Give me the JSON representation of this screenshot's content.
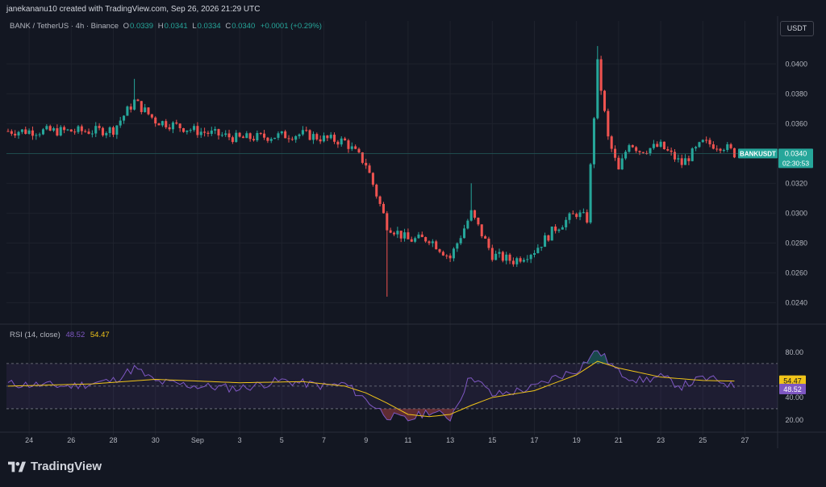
{
  "header": {
    "attribution": "janekananu10 created with TradingView.com, Sep 26, 2026 21:29 UTC"
  },
  "legend": {
    "symbol": "BANK / TetherUS · 4h · Binance",
    "o_label": "O",
    "o_value": "0.0339",
    "h_label": "H",
    "h_value": "0.0341",
    "l_label": "L",
    "l_value": "0.0334",
    "c_label": "C",
    "c_value": "0.0340",
    "change": "+0.0001 (+0.29%)"
  },
  "currency_button": "USDT",
  "price_label": {
    "symbol": "BANKUSDT",
    "price": "0.0340",
    "countdown": "02:30:53"
  },
  "rsi_legend": {
    "title": "RSI (14, close)",
    "rsi_value": "48.52",
    "ma_value": "54.47"
  },
  "rsi_labels": {
    "ma": "54.47",
    "rsi": "48.52"
  },
  "brand": {
    "name": "TradingView"
  },
  "colors": {
    "up": "#26a69a",
    "down": "#ef5350",
    "rsi": "#7e57c2",
    "rsi_ma": "#f0c419",
    "background": "#131722"
  },
  "chart_data": [
    {
      "type": "candlestick",
      "title": "BANK / TetherUS · 4h · Binance",
      "yticks": [
        "0.0400",
        "0.0380",
        "0.0360",
        "0.0340",
        "0.0320",
        "0.0300",
        "0.0280",
        "0.0260",
        "0.0240"
      ],
      "xticks": [
        "24",
        "26",
        "28",
        "30",
        "Sep",
        "3",
        "5",
        "7",
        "9",
        "11",
        "13",
        "15",
        "17",
        "19",
        "21",
        "23",
        "25",
        "27"
      ],
      "ylim": [
        0.0231,
        0.0418
      ],
      "last_price": 0.034,
      "grid": true,
      "trend_keyframes": [
        {
          "x": "Aug 23",
          "close": 0.0355
        },
        {
          "x": "Aug 27",
          "close": 0.0355
        },
        {
          "x": "Aug 28",
          "close": 0.0356
        },
        {
          "x": "Aug 29",
          "close": 0.0375
        },
        {
          "x": "Aug 30",
          "close": 0.0362
        },
        {
          "x": "Sep 1",
          "close": 0.0355
        },
        {
          "x": "Sep 3",
          "close": 0.035
        },
        {
          "x": "Sep 5",
          "close": 0.0352
        },
        {
          "x": "Sep 6",
          "close": 0.0353
        },
        {
          "x": "Sep 7",
          "close": 0.035
        },
        {
          "x": "Sep 8",
          "close": 0.0348
        },
        {
          "x": "Sep 9",
          "close": 0.0333
        },
        {
          "x": "Sep 10",
          "close": 0.0292
        },
        {
          "x": "Sep 11",
          "close": 0.0282
        },
        {
          "x": "Sep 12",
          "close": 0.0283
        },
        {
          "x": "Sep 13",
          "close": 0.027
        },
        {
          "x": "Sep 14",
          "close": 0.03
        },
        {
          "x": "Sep 15",
          "close": 0.0272
        },
        {
          "x": "Sep 16",
          "close": 0.0268
        },
        {
          "x": "Sep 17",
          "close": 0.0275
        },
        {
          "x": "Sep 18",
          "close": 0.029
        },
        {
          "x": "Sep 19",
          "close": 0.03
        },
        {
          "x": "Sep 19 12:00",
          "close": 0.0296
        },
        {
          "x": "Sep 20",
          "close": 0.04
        },
        {
          "x": "Sep 20 12:00",
          "close": 0.035
        },
        {
          "x": "Sep 21",
          "close": 0.0328
        },
        {
          "x": "Sep 21 12:00",
          "close": 0.0348
        },
        {
          "x": "Sep 22",
          "close": 0.0342
        },
        {
          "x": "Sep 23",
          "close": 0.0345
        },
        {
          "x": "Sep 24",
          "close": 0.0333
        },
        {
          "x": "Sep 25",
          "close": 0.0347
        },
        {
          "x": "Sep 26",
          "close": 0.0345
        },
        {
          "x": "Sep 26 12:00",
          "close": 0.034
        }
      ],
      "spikes": [
        {
          "x": "Aug 29",
          "high": 0.039
        },
        {
          "x": "Sep 10",
          "low": 0.0244
        },
        {
          "x": "Sep 14",
          "high": 0.032
        },
        {
          "x": "Sep 20",
          "high": 0.0412
        }
      ]
    },
    {
      "type": "line",
      "title": "RSI (14, close)",
      "yticks": [
        "80.00",
        "40.00",
        "20.00"
      ],
      "ylim": [
        10,
        92
      ],
      "band": [
        30,
        70
      ],
      "series": [
        {
          "name": "RSI",
          "keyframes": [
            {
              "x": "Aug 23",
              "y": 52
            },
            {
              "x": "Aug 26",
              "y": 50
            },
            {
              "x": "Aug 28",
              "y": 55
            },
            {
              "x": "Aug 29",
              "y": 66
            },
            {
              "x": "Aug 30",
              "y": 54
            },
            {
              "x": "Sep 1",
              "y": 50
            },
            {
              "x": "Sep 3",
              "y": 48
            },
            {
              "x": "Sep 5",
              "y": 55
            },
            {
              "x": "Sep 7",
              "y": 50
            },
            {
              "x": "Sep 8",
              "y": 52
            },
            {
              "x": "Sep 9",
              "y": 38
            },
            {
              "x": "Sep 10",
              "y": 24
            },
            {
              "x": "Sep 11",
              "y": 20
            },
            {
              "x": "Sep 12",
              "y": 28
            },
            {
              "x": "Sep 13",
              "y": 22
            },
            {
              "x": "Sep 14",
              "y": 60
            },
            {
              "x": "Sep 15",
              "y": 42
            },
            {
              "x": "Sep 16",
              "y": 45
            },
            {
              "x": "Sep 17",
              "y": 49
            },
            {
              "x": "Sep 18",
              "y": 58
            },
            {
              "x": "Sep 19",
              "y": 64
            },
            {
              "x": "Sep 20",
              "y": 82
            },
            {
              "x": "Sep 21",
              "y": 62
            },
            {
              "x": "Sep 22",
              "y": 55
            },
            {
              "x": "Sep 23",
              "y": 58
            },
            {
              "x": "Sep 24",
              "y": 50
            },
            {
              "x": "Sep 25",
              "y": 57
            },
            {
              "x": "Sep 26",
              "y": 54
            },
            {
              "x": "Sep 26 12:00",
              "y": 48.52
            }
          ]
        },
        {
          "name": "RSI-based MA",
          "keyframes": [
            {
              "x": "Aug 23",
              "y": 50
            },
            {
              "x": "Aug 27",
              "y": 52
            },
            {
              "x": "Aug 30",
              "y": 56
            },
            {
              "x": "Sep 3",
              "y": 53
            },
            {
              "x": "Sep 6",
              "y": 54
            },
            {
              "x": "Sep 8",
              "y": 50
            },
            {
              "x": "Sep 9",
              "y": 44
            },
            {
              "x": "Sep 10",
              "y": 35
            },
            {
              "x": "Sep 11",
              "y": 25
            },
            {
              "x": "Sep 12",
              "y": 23
            },
            {
              "x": "Sep 13",
              "y": 25
            },
            {
              "x": "Sep 14",
              "y": 33
            },
            {
              "x": "Sep 15",
              "y": 40
            },
            {
              "x": "Sep 17",
              "y": 46
            },
            {
              "x": "Sep 18",
              "y": 53
            },
            {
              "x": "Sep 19",
              "y": 60
            },
            {
              "x": "Sep 20",
              "y": 72
            },
            {
              "x": "Sep 21",
              "y": 66
            },
            {
              "x": "Sep 23",
              "y": 58
            },
            {
              "x": "Sep 25",
              "y": 55
            },
            {
              "x": "Sep 26 12:00",
              "y": 54.47
            }
          ]
        }
      ]
    }
  ]
}
